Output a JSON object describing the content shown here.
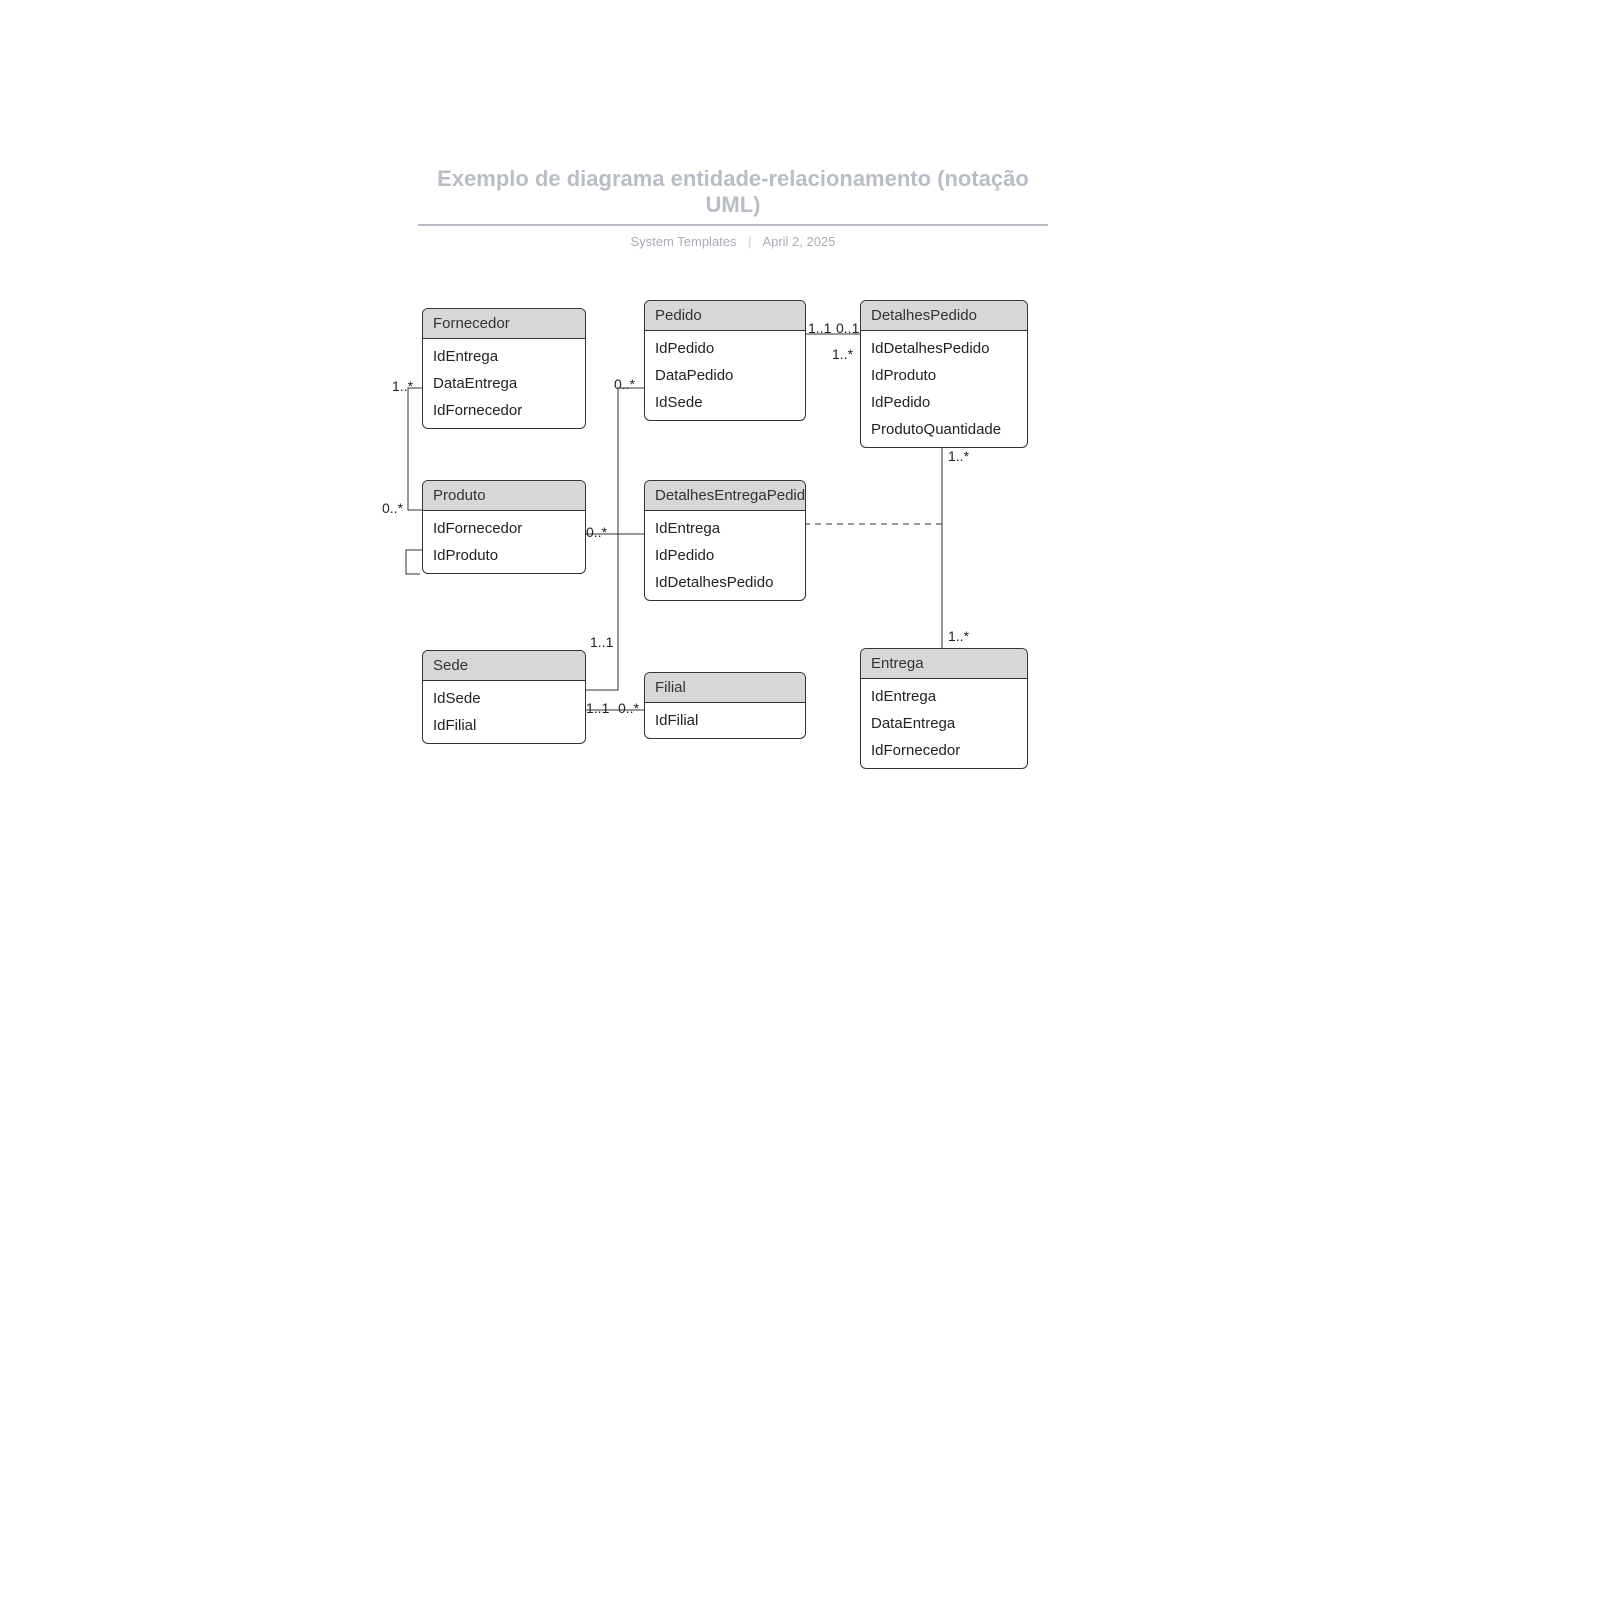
{
  "header": {
    "title": "Exemplo de diagrama entidade-relacionamento (notação UML)",
    "templates_label": "System Templates",
    "date": "April 2, 2025"
  },
  "entities": {
    "fornecedor": {
      "name": "Fornecedor",
      "attrs": [
        "IdEntrega",
        "DataEntrega",
        "IdFornecedor"
      ]
    },
    "pedido": {
      "name": "Pedido",
      "attrs": [
        "IdPedido",
        "DataPedido",
        "IdSede"
      ]
    },
    "detalhes_pedido": {
      "name": "DetalhesPedido",
      "attrs": [
        "IdDetalhesPedido",
        "IdProduto",
        "IdPedido",
        "ProdutoQuantidade"
      ]
    },
    "produto": {
      "name": "Produto",
      "attrs": [
        "IdFornecedor",
        "IdProduto"
      ]
    },
    "detalhes_entrega_pedido": {
      "name": "DetalhesEntregaPedido",
      "attrs": [
        "IdEntrega",
        "IdPedido",
        "IdDetalhesPedido"
      ]
    },
    "sede": {
      "name": "Sede",
      "attrs": [
        "IdSede",
        "IdFilial"
      ]
    },
    "filial": {
      "name": "Filial",
      "attrs": [
        "IdFilial"
      ]
    },
    "entrega": {
      "name": "Entrega",
      "attrs": [
        "IdEntrega",
        "DataEntrega",
        "IdFornecedor"
      ]
    }
  },
  "multiplicities": {
    "forn_prod_top": "1..*",
    "forn_prod_bot": "0..*",
    "prod_ped_left": "0..*",
    "prod_ped_right": "0..*",
    "ped_det_left": "1..1",
    "ped_det_right": "0..1",
    "det_entrega_top": "1..*",
    "det_entrega_bot": "1..*",
    "det_entrega_bot2": "1..*",
    "sede_ped": "1..1",
    "sede_filial_left": "1..1",
    "sede_filial_right": "0..*"
  }
}
